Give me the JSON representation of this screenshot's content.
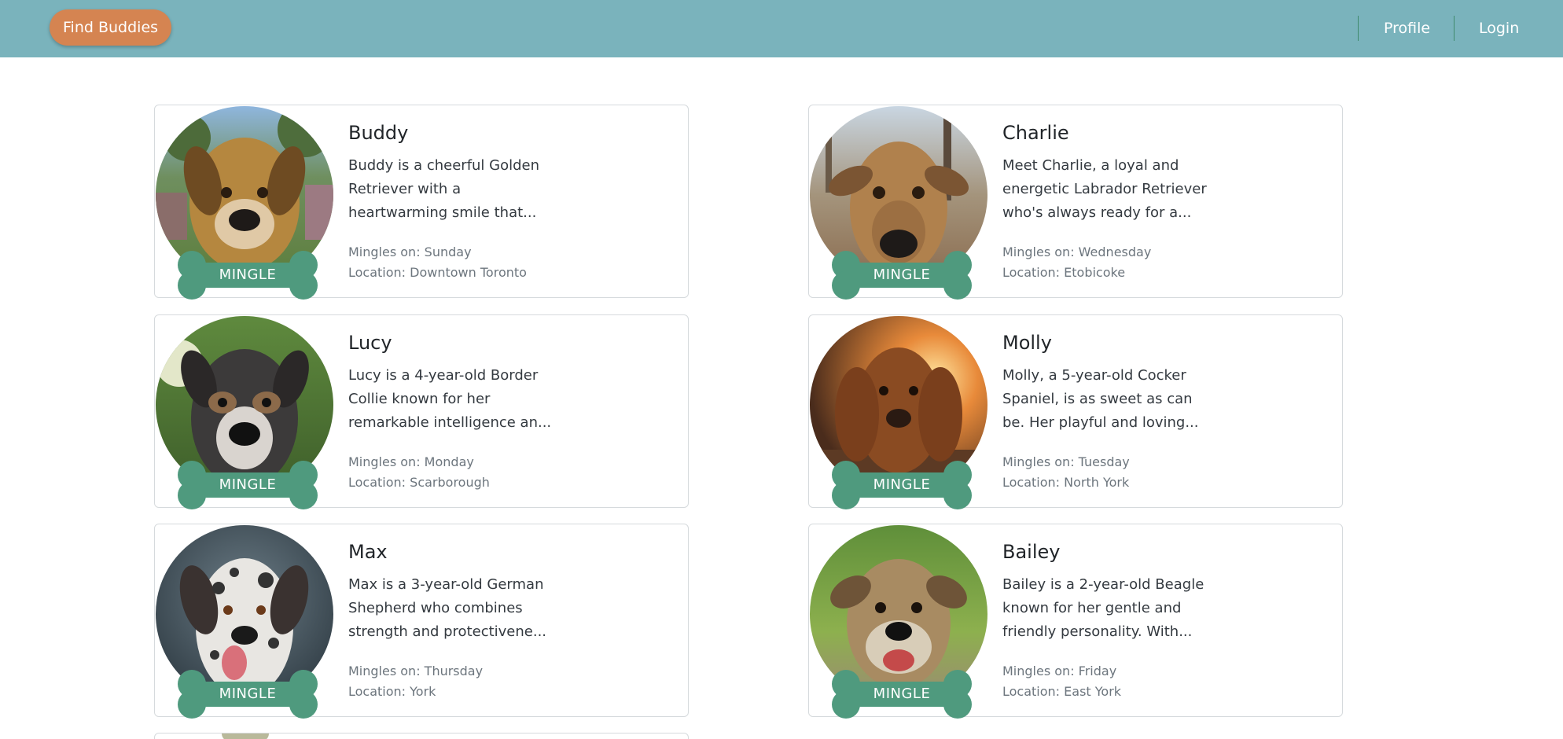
{
  "navbar": {
    "brand_label": "Find Buddies",
    "links": [
      "Profile",
      "Login"
    ]
  },
  "colors": {
    "navbar": "#7ab3bc",
    "brand_button": "#d58451",
    "mingle_bone": "#4f9a7e"
  },
  "mingle_label": "MINGLE",
  "mingles_prefix": "Mingles on: ",
  "location_prefix": "Location: ",
  "dogs": [
    {
      "name": "Buddy",
      "description": [
        "Buddy is a cheerful Golden",
        "Retriever with a",
        "heartwarming smile that..."
      ],
      "day": "Sunday",
      "location": "Downtown Toronto"
    },
    {
      "name": "Charlie",
      "description": [
        "Meet Charlie, a loyal and",
        "energetic Labrador Retriever",
        "who's always ready for a..."
      ],
      "day": "Wednesday",
      "location": "Etobicoke"
    },
    {
      "name": "Lucy",
      "description": [
        "Lucy is a 4-year-old Border",
        "Collie known for her",
        "remarkable intelligence an..."
      ],
      "day": "Monday",
      "location": "Scarborough"
    },
    {
      "name": "Molly",
      "description": [
        "Molly, a 5-year-old Cocker",
        "Spaniel, is as sweet as can",
        "be. Her playful and loving..."
      ],
      "day": "Tuesday",
      "location": "North York"
    },
    {
      "name": "Max",
      "description": [
        "Max is a 3-year-old German",
        "Shepherd who combines",
        "strength and protectivene..."
      ],
      "day": "Thursday",
      "location": "York"
    },
    {
      "name": "Bailey",
      "description": [
        "Bailey is a 2-year-old Beagle",
        "known for her gentle and",
        "friendly personality. With..."
      ],
      "day": "Friday",
      "location": "East York"
    }
  ]
}
